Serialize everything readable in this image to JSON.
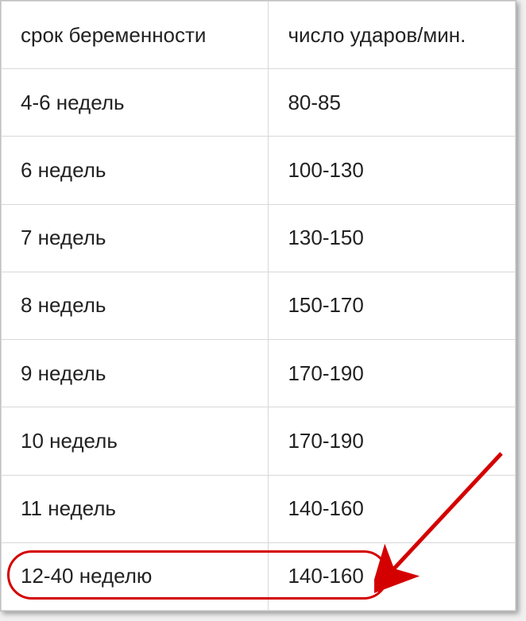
{
  "table": {
    "headers": {
      "col1": "срок беременности",
      "col2": "число ударов/мин."
    },
    "rows": [
      {
        "col1": "4-6 недель",
        "col2": "80-85"
      },
      {
        "col1": "6 недель",
        "col2": "100-130"
      },
      {
        "col1": "7 недель",
        "col2": "130-150"
      },
      {
        "col1": "8 недель",
        "col2": "150-170"
      },
      {
        "col1": "9 недель",
        "col2": "170-190"
      },
      {
        "col1": "10 недель",
        "col2": "170-190"
      },
      {
        "col1": "11 недель",
        "col2": "140-160"
      },
      {
        "col1": "12-40 неделю",
        "col2": "140-160"
      }
    ]
  },
  "annotation": {
    "highlight_row_index": 7,
    "arrow_color": "#d40000"
  }
}
